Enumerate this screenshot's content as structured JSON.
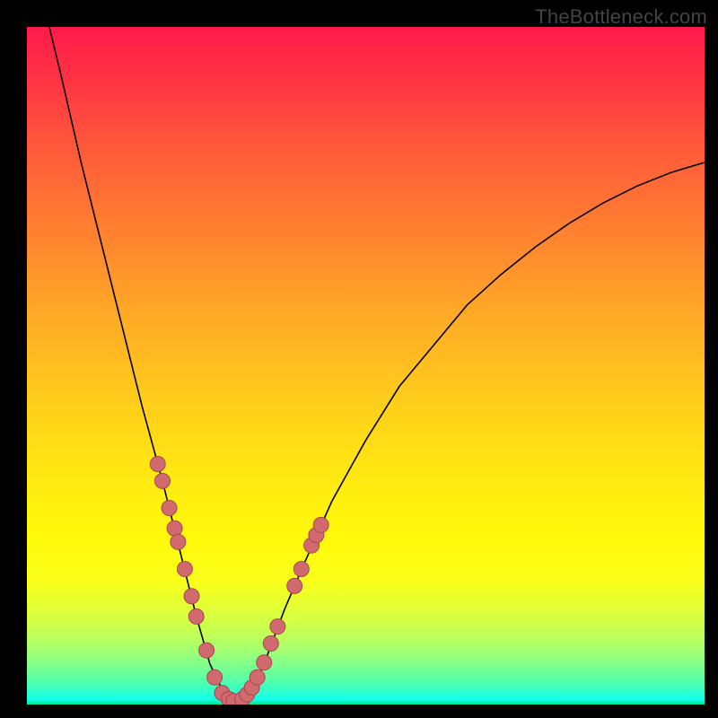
{
  "watermark": "TheBottleneck.com",
  "chart_data": {
    "type": "line",
    "title": "",
    "xlabel": "",
    "ylabel": "",
    "xlim": [
      0,
      100
    ],
    "ylim": [
      0,
      100
    ],
    "curve": [
      {
        "x": 3.3,
        "y": 100
      },
      {
        "x": 5,
        "y": 93
      },
      {
        "x": 8,
        "y": 80
      },
      {
        "x": 11,
        "y": 68
      },
      {
        "x": 14,
        "y": 56
      },
      {
        "x": 17,
        "y": 44
      },
      {
        "x": 20,
        "y": 33
      },
      {
        "x": 23,
        "y": 21
      },
      {
        "x": 25,
        "y": 13
      },
      {
        "x": 27,
        "y": 6
      },
      {
        "x": 29,
        "y": 1.8
      },
      {
        "x": 30,
        "y": 0.8
      },
      {
        "x": 31,
        "y": 0.5
      },
      {
        "x": 32,
        "y": 0.8
      },
      {
        "x": 33,
        "y": 1.8
      },
      {
        "x": 35,
        "y": 6
      },
      {
        "x": 38,
        "y": 14
      },
      {
        "x": 41,
        "y": 21
      },
      {
        "x": 45,
        "y": 30
      },
      {
        "x": 50,
        "y": 39
      },
      {
        "x": 55,
        "y": 47
      },
      {
        "x": 60,
        "y": 53
      },
      {
        "x": 65,
        "y": 59
      },
      {
        "x": 70,
        "y": 63.5
      },
      {
        "x": 75,
        "y": 67.5
      },
      {
        "x": 80,
        "y": 71
      },
      {
        "x": 85,
        "y": 74
      },
      {
        "x": 90,
        "y": 76.5
      },
      {
        "x": 95,
        "y": 78.5
      },
      {
        "x": 100,
        "y": 80
      }
    ],
    "markers": [
      {
        "x": 19.3,
        "y": 35.5
      },
      {
        "x": 20.0,
        "y": 33.0
      },
      {
        "x": 21.0,
        "y": 29.0
      },
      {
        "x": 21.8,
        "y": 26.0
      },
      {
        "x": 22.3,
        "y": 24.0
      },
      {
        "x": 23.3,
        "y": 20.0
      },
      {
        "x": 24.3,
        "y": 16.0
      },
      {
        "x": 25.0,
        "y": 13.0
      },
      {
        "x": 26.5,
        "y": 8.0
      },
      {
        "x": 27.7,
        "y": 4.0
      },
      {
        "x": 28.8,
        "y": 1.7
      },
      {
        "x": 29.8,
        "y": 0.8
      },
      {
        "x": 30.5,
        "y": 0.5
      },
      {
        "x": 31.8,
        "y": 0.8
      },
      {
        "x": 32.5,
        "y": 1.5
      },
      {
        "x": 33.2,
        "y": 2.5
      },
      {
        "x": 34.0,
        "y": 4.0
      },
      {
        "x": 35.0,
        "y": 6.2
      },
      {
        "x": 36.0,
        "y": 9.0
      },
      {
        "x": 37.0,
        "y": 11.5
      },
      {
        "x": 39.5,
        "y": 17.5
      },
      {
        "x": 40.5,
        "y": 20.0
      },
      {
        "x": 42.0,
        "y": 23.5
      },
      {
        "x": 42.7,
        "y": 25.0
      },
      {
        "x": 43.4,
        "y": 26.5
      }
    ],
    "curve_color": "#000000",
    "marker_fill": "#d06a6f",
    "marker_stroke": "#a8484e"
  }
}
